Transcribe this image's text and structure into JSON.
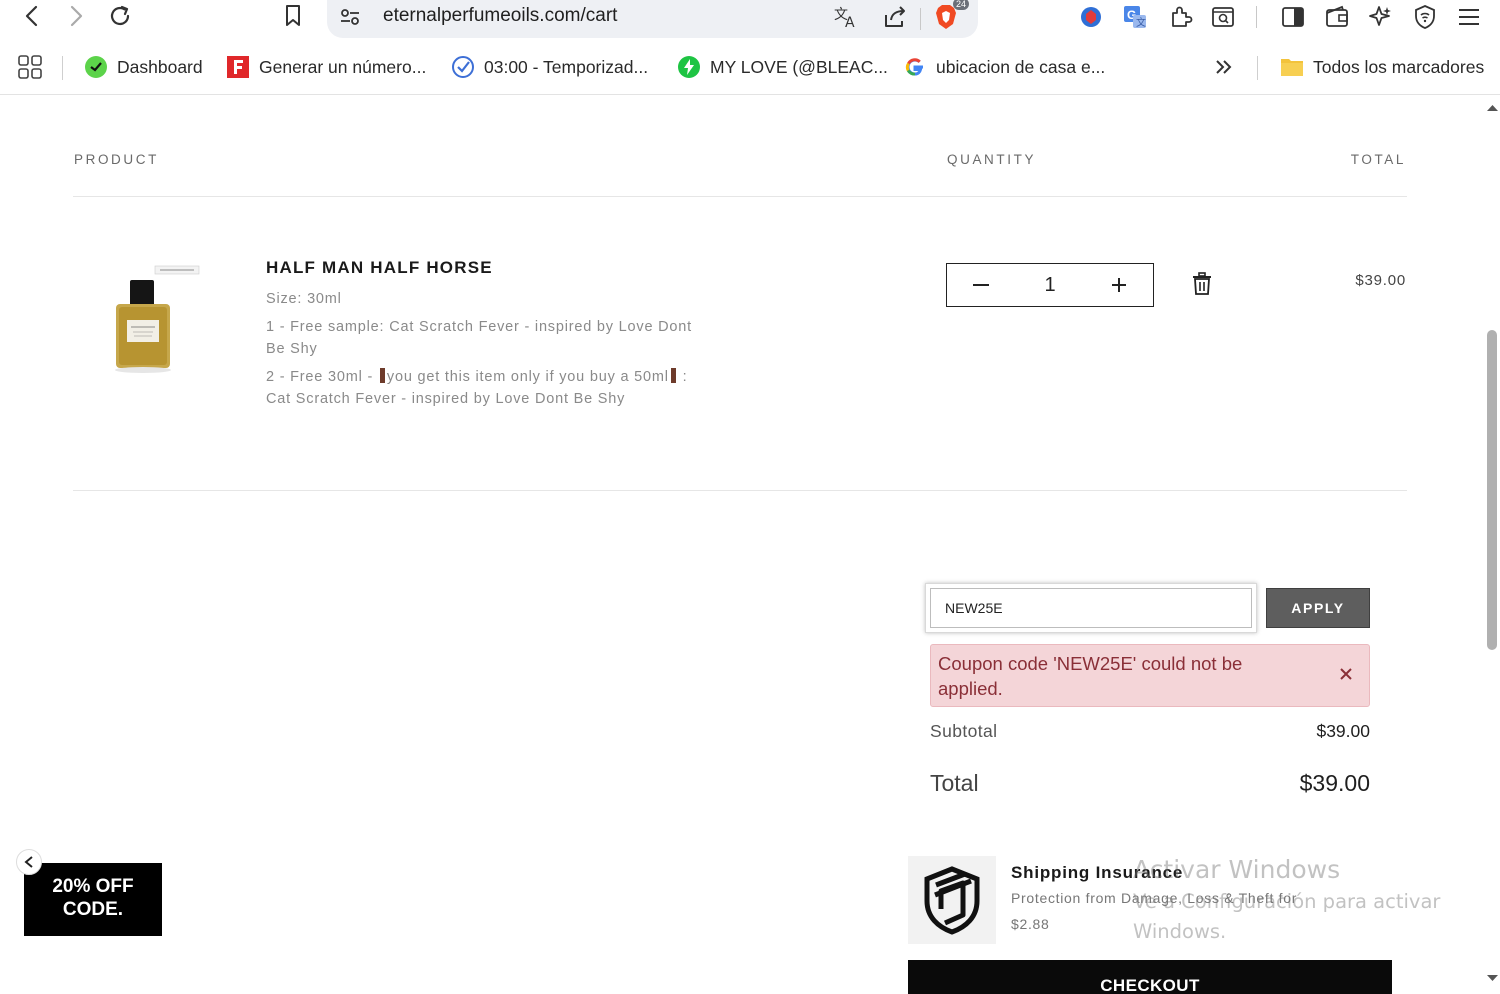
{
  "browser": {
    "url": "eternalperfumeoils.com/cart",
    "brave_badge": "24",
    "bookmarks": [
      {
        "label": "Dashboard"
      },
      {
        "label": "Generar un número..."
      },
      {
        "label": "03:00 - Temporizad..."
      },
      {
        "label": "MY LOVE (@BLEAC..."
      },
      {
        "label": "ubicacion de casa e..."
      }
    ],
    "all_bookmarks_label": "Todos los marcadores"
  },
  "cart": {
    "headers": {
      "product": "PRODUCT",
      "quantity": "QUANTITY",
      "total": "TOTAL"
    },
    "item": {
      "title": "HALF MAN HALF HORSE",
      "size": "Size: 30ml",
      "sample1": "1 - Free sample: Cat Scratch Fever - inspired by Love Dont Be Shy",
      "sample2_a": "2 - Free 30ml - ",
      "sample2_b": "you get this item only if you buy a 50ml",
      "sample2_c": " : Cat Scratch Fever - inspired by Love Dont Be Shy",
      "quantity": "1",
      "price": "$39.00"
    },
    "coupon": {
      "value": "NEW25E",
      "apply_label": "APPLY",
      "error": "Coupon code 'NEW25E' could not be applied."
    },
    "subtotal_label": "Subtotal",
    "subtotal_value": "$39.00",
    "total_label": "Total",
    "total_value": "$39.00",
    "shipping": {
      "title": "Shipping Insurance",
      "desc": "Protection from Damage, Loss & Theft for",
      "price": "$2.88"
    },
    "checkout_label": "CHECKOUT"
  },
  "promo": {
    "line1": "20% OFF",
    "line2": "CODE."
  },
  "watermark": {
    "title": "Activar Windows",
    "sub": "Ve a Configuración para activar Windows."
  },
  "colors": {
    "alert_bg": "#f4d5d8",
    "alert_text": "#8a2f37",
    "apply_bg": "#5e5e5e",
    "checkout_bg": "#0a0a0a"
  }
}
